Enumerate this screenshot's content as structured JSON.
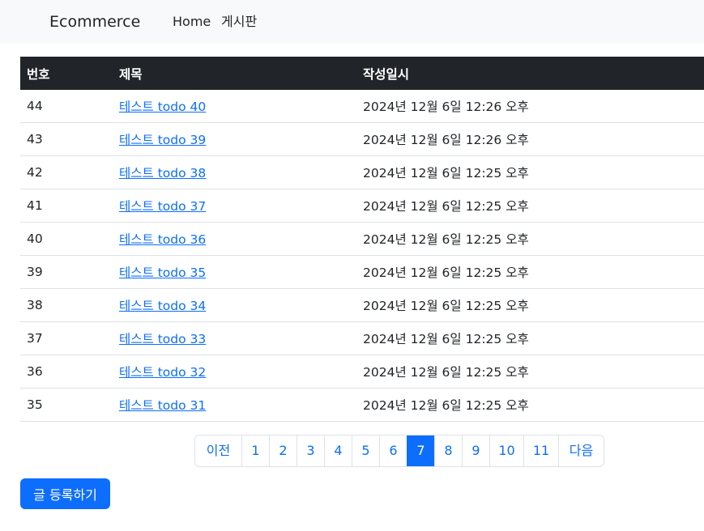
{
  "navbar": {
    "brand": "Ecommerce",
    "links": [
      "Home",
      "게시판"
    ]
  },
  "table": {
    "headers": [
      "번호",
      "제목",
      "작성일시"
    ],
    "rows": [
      {
        "num": "44",
        "title": "테스트 todo 40",
        "date": "2024년 12월 6일 12:26 오후"
      },
      {
        "num": "43",
        "title": "테스트 todo 39",
        "date": "2024년 12월 6일 12:26 오후"
      },
      {
        "num": "42",
        "title": "테스트 todo 38",
        "date": "2024년 12월 6일 12:25 오후"
      },
      {
        "num": "41",
        "title": "테스트 todo 37",
        "date": "2024년 12월 6일 12:25 오후"
      },
      {
        "num": "40",
        "title": "테스트 todo 36",
        "date": "2024년 12월 6일 12:25 오후"
      },
      {
        "num": "39",
        "title": "테스트 todo 35",
        "date": "2024년 12월 6일 12:25 오후"
      },
      {
        "num": "38",
        "title": "테스트 todo 34",
        "date": "2024년 12월 6일 12:25 오후"
      },
      {
        "num": "37",
        "title": "테스트 todo 33",
        "date": "2024년 12월 6일 12:25 오후"
      },
      {
        "num": "36",
        "title": "테스트 todo 32",
        "date": "2024년 12월 6일 12:25 오후"
      },
      {
        "num": "35",
        "title": "테스트 todo 31",
        "date": "2024년 12월 6일 12:25 오후"
      }
    ]
  },
  "pagination": {
    "prev": "이전",
    "pages": [
      "1",
      "2",
      "3",
      "4",
      "5",
      "6",
      "7",
      "8",
      "9",
      "10",
      "11"
    ],
    "current": "7",
    "next": "다음"
  },
  "write_button": "글 등록하기",
  "colors": {
    "primary": "#0d6efd",
    "table_header": "#212529",
    "navbar_bg": "#f8f9fa"
  }
}
